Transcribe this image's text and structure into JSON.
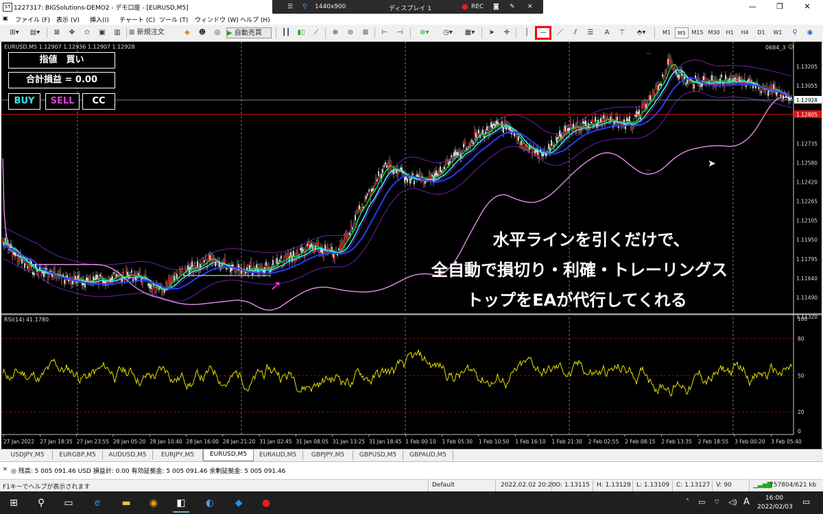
{
  "window": {
    "title": "1227317: BIGSolutions-DEMO2 - デモ口座 - [EURUSD,M5]",
    "app_icon": "ST"
  },
  "recorder": {
    "resolution": "1440x900",
    "display": "ディスプレイ 1",
    "rec": "REC"
  },
  "menu": [
    "ファイル (F)",
    "表示 (V)",
    "挿入(I)",
    "チャート (C)",
    "ツール (T)",
    "ウィンドウ (W)",
    "ヘルプ (H)"
  ],
  "toolbar": {
    "new_order": "新規注文",
    "auto_trade": "自動売買",
    "draw_text": "A",
    "timeframes": [
      "M1",
      "M5",
      "M15",
      "M30",
      "H1",
      "H4",
      "D1",
      "W1"
    ],
    "selected_timeframe": "M5"
  },
  "chart": {
    "header": "EURUSD,M5  1.12907 1.12936 1.12907 1.12928",
    "corner_label": "0684_3",
    "rsi_label": "RSI(14) 41.1780",
    "price_labels": [
      "1.13205",
      "1.13055",
      "1.12928",
      "1.12805",
      "1.12735",
      "1.12580",
      "1.12420",
      "1.12265",
      "1.12105",
      "1.11950",
      "1.11795",
      "1.11640",
      "1.11490",
      "1.11320"
    ],
    "current_price": "1.12928",
    "red_line_price": "1.12805",
    "rsi_levels": [
      "100",
      "80",
      "50",
      "20",
      "0"
    ],
    "time_labels": [
      "27 Jan 2022",
      "27 Jan 18:35",
      "27 Jan 23:55",
      "28 Jan 05:20",
      "28 Jan 10:40",
      "28 Jan 16:00",
      "28 Jan 21:20",
      "31 Jan 02:45",
      "31 Jan 08:05",
      "31 Jan 13:25",
      "31 Jan 18:45",
      "1 Feb 00:10",
      "1 Feb 05:30",
      "1 Feb 10:50",
      "1 Feb 16:10",
      "1 Feb 21:30",
      "2 Feb 02:55",
      "2 Feb 08:15",
      "2 Feb 13:35",
      "2 Feb 18:55",
      "3 Feb 00:20",
      "3 Feb 05:40"
    ],
    "colors": {
      "candles": "#ff2020",
      "green_ma": "#21c74a",
      "cyan_ma": "#35e6ee",
      "blue_ma": "#2a3cf2",
      "pink_line": "#e58ce8",
      "purple_band": "#7a22c0",
      "rsi": "#e6e000",
      "arrow": "#ff2bd6"
    }
  },
  "panel": {
    "order_type": "指値　買い",
    "total_pl": "合計損益 = 0.00",
    "buy": "BUY",
    "sell": "SELL",
    "cc": "CC"
  },
  "caption": {
    "line1": "水平ラインを引くだけで、",
    "line2": "全自動で損切り・利確・トレーリングス",
    "line3": "トップをEAが代行してくれる"
  },
  "symbol_tabs": [
    "USDJPY,M5",
    "EURGBP,M5",
    "AUDUSD,M5",
    "EURJPY,M5",
    "EURUSD,M5",
    "EURAUD,M5",
    "GBPJPY,M5",
    "GBPUSD,M5",
    "GBPAUD,M5"
  ],
  "active_tab": "EURUSD,M5",
  "terminal": "残高: 5 005 091.46 USD  損益計: 0.00  有効証拠金: 5 005 091.46  余剰証拠金: 5 005 091.46",
  "status": {
    "help": "F1キーでヘルプが表示されます",
    "profile": "Default",
    "datetime": "2022.02.02 20:20",
    "open": "O: 1.13115",
    "high": "H: 1.13128",
    "low": "L: 1.13109",
    "close": "C: 1.13127",
    "volume": "V: 90",
    "traffic": "757804/621 kb"
  },
  "taskbar": {
    "time": "16:00",
    "date": "2022/02/03",
    "ime": "A"
  }
}
